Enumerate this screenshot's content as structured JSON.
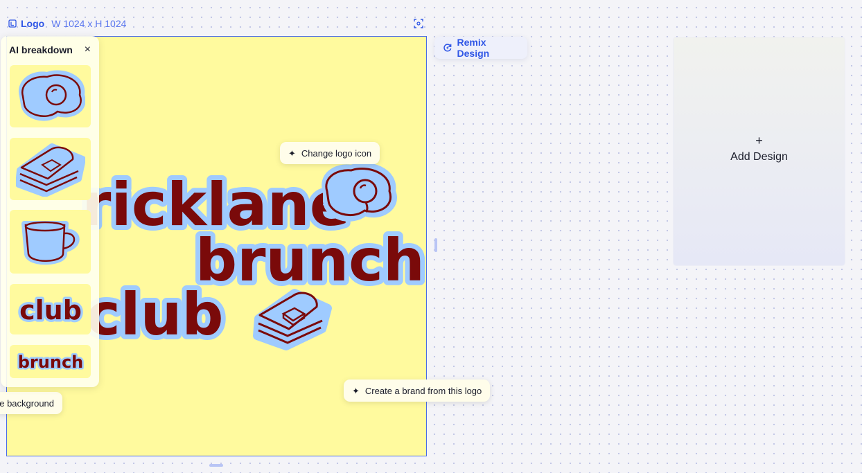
{
  "canvas": {
    "name": "Logo",
    "dimensions": "W 1024 x H 1024"
  },
  "artboard": {
    "background_color": "#fffa9e",
    "words": [
      "ricklane",
      "brunch",
      "club"
    ]
  },
  "actions": {
    "remix": "Remix Design",
    "change_logo_icon": "Change logo icon",
    "create_brand": "Create a brand from this logo",
    "change_background": "ge background"
  },
  "add_design": {
    "plus": "+",
    "label": "Add Design"
  },
  "panel": {
    "title": "AI breakdown",
    "close": "×",
    "items": [
      {
        "name": "fried-egg"
      },
      {
        "name": "toast-stack"
      },
      {
        "name": "coffee-cup"
      },
      {
        "name": "club",
        "text": "club"
      },
      {
        "name": "brunch",
        "text": "brunch"
      }
    ]
  },
  "colors": {
    "accent": "#2f56e6",
    "text_fill": "#7a0a0a",
    "outline_blue": "#9fcbff",
    "artboard_yellow": "#fffa9e"
  },
  "icons": [
    "frame-icon",
    "fit-screen-icon",
    "remix-icon",
    "sparkle-icon",
    "close-icon",
    "plus-icon"
  ]
}
